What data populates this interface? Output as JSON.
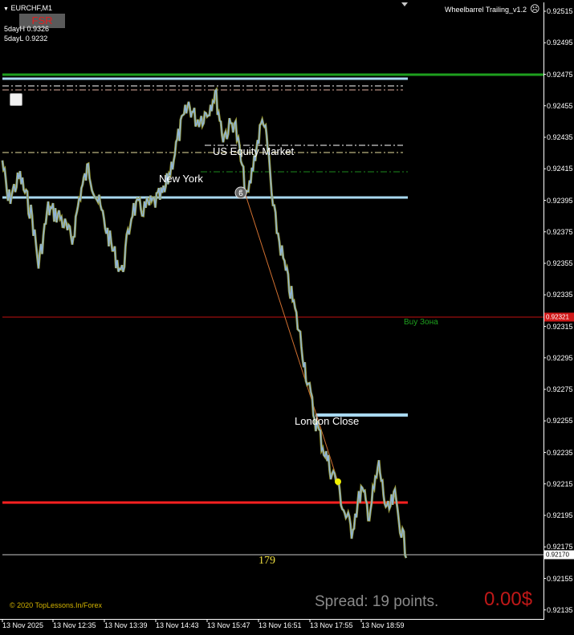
{
  "header": {
    "symbol": "EURCHF,M1",
    "fsr_label": "FSR",
    "day_high": "5dayH 0.9326",
    "day_low": "5dayL 0.9232",
    "indicator_name": "Wheelbarrel Trailing_v1.2"
  },
  "y_ticks": [
    "0.92515",
    "0.92495",
    "0.92475",
    "0.92455",
    "0.92435",
    "0.92415",
    "0.92395",
    "0.92375",
    "0.92355",
    "0.92335",
    "0.92315",
    "0.92295",
    "0.92275",
    "0.92255",
    "0.92235",
    "0.92215",
    "0.92195",
    "0.92175",
    "0.92155",
    "0.92135"
  ],
  "x_ticks": [
    "13 Nov 2025",
    "13 Nov 12:35",
    "13 Nov 13:39",
    "13 Nov 14:43",
    "13 Nov 15:47",
    "13 Nov 16:51",
    "13 Nov 17:55",
    "13 Nov 18:59"
  ],
  "price_tags": {
    "buy_zone_price": "0.92321",
    "current_price": "0.92170"
  },
  "labels": {
    "new_york": "New York",
    "us_equity": "US Equity Market",
    "london_close": "London Close",
    "buy_zone": "Buy Зона",
    "counter": "179",
    "copyright": "© 2020 TopLessons.In/Forex",
    "spread": "Spread: 19 points.",
    "profit": "0.00$"
  },
  "chart_data": {
    "type": "line",
    "title": "EURCHF,M1",
    "y_range": [
      0.92135,
      0.92515
    ],
    "x": [
      "13 Nov 2025",
      "13 Nov 12:35",
      "13 Nov 13:39",
      "13 Nov 14:43",
      "13 Nov 15:47",
      "13 Nov 16:51",
      "13 Nov 17:55",
      "13 Nov 18:59"
    ],
    "series": [
      {
        "values": [
          0.92405,
          0.92385,
          0.92395,
          0.924,
          0.9244,
          0.9243,
          0.9239,
          0.9231,
          0.9225,
          0.9221,
          0.922,
          0.9218
        ]
      }
    ],
    "levels": [
      {
        "value": 0.92472,
        "color": "#1ea01e"
      },
      {
        "value": 0.924,
        "color": "#a8d8f0"
      },
      {
        "value": 0.92321,
        "color": "#d01010"
      },
      {
        "value": 0.9226,
        "color": "#a8d8f0"
      },
      {
        "value": 0.92205,
        "color": "#ff2020"
      },
      {
        "value": 0.9217,
        "color": "#c0c0c0"
      }
    ],
    "grid": false
  },
  "colors": {
    "background": "#000000",
    "axis": "#ffffff",
    "price_line": "#8fb4d8",
    "wick_shadow": "#9a9a30",
    "green_level": "#1ea01e",
    "red_level": "#ff2020",
    "buy_zone": "#1ea01e",
    "profit": "#c01818",
    "spread": "#8a8a8a",
    "counter": "#f0e040",
    "copyright": "#d4b400"
  }
}
